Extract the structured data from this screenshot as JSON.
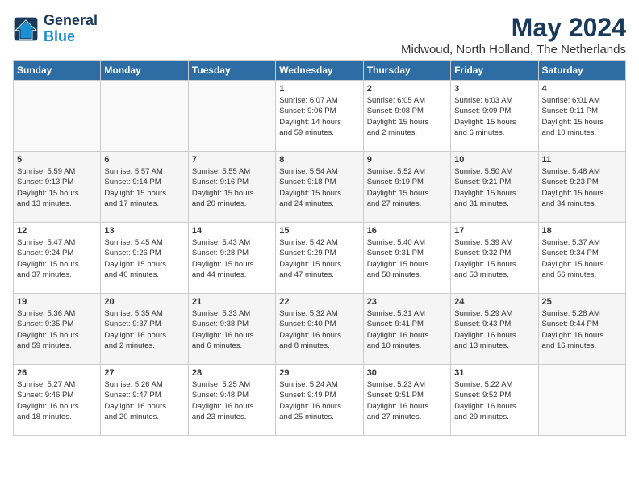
{
  "logo": {
    "line1": "General",
    "line2": "Blue"
  },
  "title": "May 2024",
  "location": "Midwoud, North Holland, The Netherlands",
  "weekdays": [
    "Sunday",
    "Monday",
    "Tuesday",
    "Wednesday",
    "Thursday",
    "Friday",
    "Saturday"
  ],
  "weeks": [
    [
      {
        "day": "",
        "info": ""
      },
      {
        "day": "",
        "info": ""
      },
      {
        "day": "",
        "info": ""
      },
      {
        "day": "1",
        "info": "Sunrise: 6:07 AM\nSunset: 9:06 PM\nDaylight: 14 hours\nand 59 minutes."
      },
      {
        "day": "2",
        "info": "Sunrise: 6:05 AM\nSunset: 9:08 PM\nDaylight: 15 hours\nand 2 minutes."
      },
      {
        "day": "3",
        "info": "Sunrise: 6:03 AM\nSunset: 9:09 PM\nDaylight: 15 hours\nand 6 minutes."
      },
      {
        "day": "4",
        "info": "Sunrise: 6:01 AM\nSunset: 9:11 PM\nDaylight: 15 hours\nand 10 minutes."
      }
    ],
    [
      {
        "day": "5",
        "info": "Sunrise: 5:59 AM\nSunset: 9:13 PM\nDaylight: 15 hours\nand 13 minutes."
      },
      {
        "day": "6",
        "info": "Sunrise: 5:57 AM\nSunset: 9:14 PM\nDaylight: 15 hours\nand 17 minutes."
      },
      {
        "day": "7",
        "info": "Sunrise: 5:55 AM\nSunset: 9:16 PM\nDaylight: 15 hours\nand 20 minutes."
      },
      {
        "day": "8",
        "info": "Sunrise: 5:54 AM\nSunset: 9:18 PM\nDaylight: 15 hours\nand 24 minutes."
      },
      {
        "day": "9",
        "info": "Sunrise: 5:52 AM\nSunset: 9:19 PM\nDaylight: 15 hours\nand 27 minutes."
      },
      {
        "day": "10",
        "info": "Sunrise: 5:50 AM\nSunset: 9:21 PM\nDaylight: 15 hours\nand 31 minutes."
      },
      {
        "day": "11",
        "info": "Sunrise: 5:48 AM\nSunset: 9:23 PM\nDaylight: 15 hours\nand 34 minutes."
      }
    ],
    [
      {
        "day": "12",
        "info": "Sunrise: 5:47 AM\nSunset: 9:24 PM\nDaylight: 15 hours\nand 37 minutes."
      },
      {
        "day": "13",
        "info": "Sunrise: 5:45 AM\nSunset: 9:26 PM\nDaylight: 15 hours\nand 40 minutes."
      },
      {
        "day": "14",
        "info": "Sunrise: 5:43 AM\nSunset: 9:28 PM\nDaylight: 15 hours\nand 44 minutes."
      },
      {
        "day": "15",
        "info": "Sunrise: 5:42 AM\nSunset: 9:29 PM\nDaylight: 15 hours\nand 47 minutes."
      },
      {
        "day": "16",
        "info": "Sunrise: 5:40 AM\nSunset: 9:31 PM\nDaylight: 15 hours\nand 50 minutes."
      },
      {
        "day": "17",
        "info": "Sunrise: 5:39 AM\nSunset: 9:32 PM\nDaylight: 15 hours\nand 53 minutes."
      },
      {
        "day": "18",
        "info": "Sunrise: 5:37 AM\nSunset: 9:34 PM\nDaylight: 15 hours\nand 56 minutes."
      }
    ],
    [
      {
        "day": "19",
        "info": "Sunrise: 5:36 AM\nSunset: 9:35 PM\nDaylight: 15 hours\nand 59 minutes."
      },
      {
        "day": "20",
        "info": "Sunrise: 5:35 AM\nSunset: 9:37 PM\nDaylight: 16 hours\nand 2 minutes."
      },
      {
        "day": "21",
        "info": "Sunrise: 5:33 AM\nSunset: 9:38 PM\nDaylight: 16 hours\nand 6 minutes."
      },
      {
        "day": "22",
        "info": "Sunrise: 5:32 AM\nSunset: 9:40 PM\nDaylight: 16 hours\nand 8 minutes."
      },
      {
        "day": "23",
        "info": "Sunrise: 5:31 AM\nSunset: 9:41 PM\nDaylight: 16 hours\nand 10 minutes."
      },
      {
        "day": "24",
        "info": "Sunrise: 5:29 AM\nSunset: 9:43 PM\nDaylight: 16 hours\nand 13 minutes."
      },
      {
        "day": "25",
        "info": "Sunrise: 5:28 AM\nSunset: 9:44 PM\nDaylight: 16 hours\nand 16 minutes."
      }
    ],
    [
      {
        "day": "26",
        "info": "Sunrise: 5:27 AM\nSunset: 9:46 PM\nDaylight: 16 hours\nand 18 minutes."
      },
      {
        "day": "27",
        "info": "Sunrise: 5:26 AM\nSunset: 9:47 PM\nDaylight: 16 hours\nand 20 minutes."
      },
      {
        "day": "28",
        "info": "Sunrise: 5:25 AM\nSunset: 9:48 PM\nDaylight: 16 hours\nand 23 minutes."
      },
      {
        "day": "29",
        "info": "Sunrise: 5:24 AM\nSunset: 9:49 PM\nDaylight: 16 hours\nand 25 minutes."
      },
      {
        "day": "30",
        "info": "Sunrise: 5:23 AM\nSunset: 9:51 PM\nDaylight: 16 hours\nand 27 minutes."
      },
      {
        "day": "31",
        "info": "Sunrise: 5:22 AM\nSunset: 9:52 PM\nDaylight: 16 hours\nand 29 minutes."
      },
      {
        "day": "",
        "info": ""
      }
    ]
  ]
}
